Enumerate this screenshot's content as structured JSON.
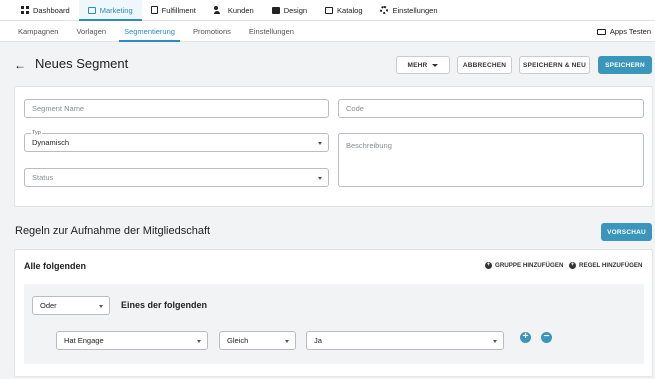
{
  "topnav": {
    "tabs": [
      {
        "label": "Dashboard",
        "icon": "dashboard-icon"
      },
      {
        "label": "Marketing",
        "icon": "message-icon",
        "active": true
      },
      {
        "label": "Fulfillment",
        "icon": "package-icon"
      },
      {
        "label": "Kunden",
        "icon": "users-icon"
      },
      {
        "label": "Design",
        "icon": "image-icon"
      },
      {
        "label": "Katalog",
        "icon": "catalog-icon"
      },
      {
        "label": "Einstellungen",
        "icon": "gear-icon"
      }
    ]
  },
  "subnav": {
    "tabs": [
      {
        "label": "Kampagnen"
      },
      {
        "label": "Vorlagen"
      },
      {
        "label": "Segmentierung",
        "active": true
      },
      {
        "label": "Promotions"
      },
      {
        "label": "Einstellungen"
      }
    ],
    "apps_label": "Apps Testen"
  },
  "header": {
    "back_icon": "←",
    "title": "Neues Segment",
    "more_label": "MEHR",
    "cancel_label": "ABBRECHEN",
    "save_new_label": "SPEICHERN & NEU",
    "save_label": "SPEICHERN"
  },
  "form": {
    "segment_name_placeholder": "Segment Name",
    "code_placeholder": "Code",
    "type_label": "Typ",
    "type_value": "Dynamisch",
    "description_placeholder": "Beschreibung",
    "status_placeholder": "Status"
  },
  "rules": {
    "title": "Regeln zur Aufnahme der Mitgliedschaft",
    "preview_label": "VORSCHAU",
    "group_title": "Alle folgenden",
    "add_group_label": "GRUPPE HINZUFÜGEN",
    "add_rule_label": "REGEL HINZUFÜGEN",
    "operator_value": "Oder",
    "subgroup_title": "Eines der folgenden",
    "condition": {
      "field": "Hat Engage",
      "comparator": "Gleich",
      "value": "Ja"
    }
  },
  "colors": {
    "accent": "#3a96ba",
    "link": "#2b8cc4"
  }
}
